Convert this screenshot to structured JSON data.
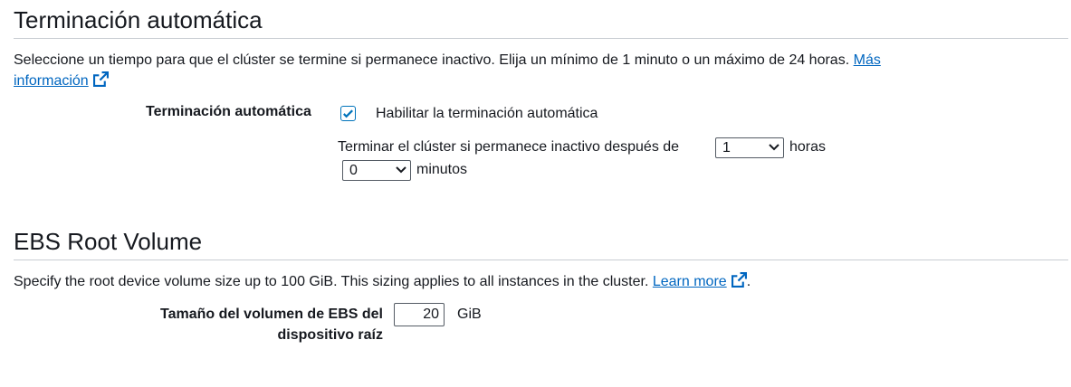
{
  "auto_termination": {
    "title": "Terminación automática",
    "description": "Seleccione un tiempo para que el clúster se termine si permanece inactivo. Elija un mínimo de 1 minuto o un máximo de 24 horas.",
    "learn_more_line1": "Más",
    "learn_more_line2": "información",
    "field_label": "Terminación automática",
    "checkbox_checked": true,
    "checkbox_label": "Habilitar la terminación automática",
    "idle_prefix": "Terminar el clúster si permanece inactivo después de",
    "hours_value": "1",
    "hours_unit": "horas",
    "minutes_value": "0",
    "minutes_unit": "minutos"
  },
  "ebs_root_volume": {
    "title": "EBS Root Volume",
    "description": "Specify the root device volume size up to 100 GiB. This sizing applies to all instances in the cluster.",
    "learn_more": "Learn more",
    "trailing_period": ".",
    "field_label_line1": "Tamaño del volumen de EBS del",
    "field_label_line2": "dispositivo raíz",
    "size_value": "20",
    "size_unit": "GiB"
  },
  "colors": {
    "link": "#0066c0",
    "accent": "#0073bb",
    "text": "#16191f",
    "divider": "#c9cdd2"
  },
  "icons": {
    "external_link": "external-link-icon",
    "checkmark": "checkmark-icon",
    "dropdown": "chevron-down-icon"
  }
}
